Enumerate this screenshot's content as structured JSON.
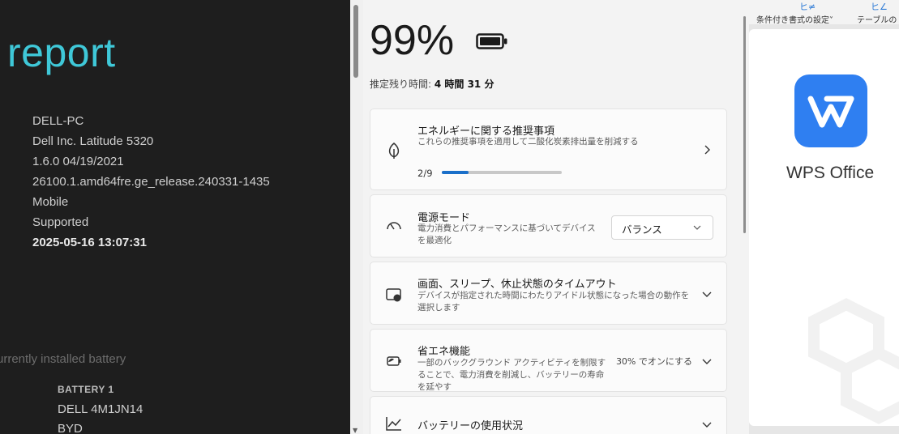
{
  "report": {
    "title": "report",
    "system_info": [
      "DELL-PC",
      "Dell Inc. Latitude 5320",
      "1.6.0 04/19/2021",
      "26100.1.amd64fre.ge_release.240331-1435",
      "Mobile",
      "Supported",
      "2025-05-16  13:07:31"
    ],
    "battery_section_heading": "urrently installed battery",
    "battery": {
      "name": "BATTERY 1",
      "details": [
        "DELL 4M1JN14",
        "BYD"
      ]
    }
  },
  "power": {
    "battery_percent": "99%",
    "remaining_label": "推定残り時間:",
    "remaining_value": "4 時間 31 分",
    "cards": {
      "energy": {
        "title": "エネルギーに関する推奨事項",
        "desc": "これらの推奨事項を適用して二酸化炭素排出量を削減する",
        "progress_label": "2/9",
        "progress_fraction": 0.22
      },
      "power_mode": {
        "title": "電源モード",
        "desc": "電力消費とパフォーマンスに基づいてデバイスを最適化",
        "selected": "バランス"
      },
      "screen_sleep": {
        "title": "画面、スリープ、休止状態のタイムアウト",
        "desc": "デバイスが指定された時間にわたりアイドル状態になった場合の動作を選択します"
      },
      "energy_saver": {
        "title": "省エネ機能",
        "desc": "一部のバックグラウンド アクティビティを制限することで、電力消費を削減し、バッテリーの寿命を延やす",
        "status": "30% でオンにする"
      },
      "battery_usage": {
        "title": "バッテリーの使用状況"
      }
    }
  },
  "wps": {
    "ribbon_labels": [
      "条件付き書式の設定˅",
      "テーブルの"
    ],
    "app_name": "WPS Office",
    "brand_color": "#2f7ff1"
  },
  "colors": {
    "report_accent": "#3fc8d8",
    "progress": "#1a6fc9"
  }
}
